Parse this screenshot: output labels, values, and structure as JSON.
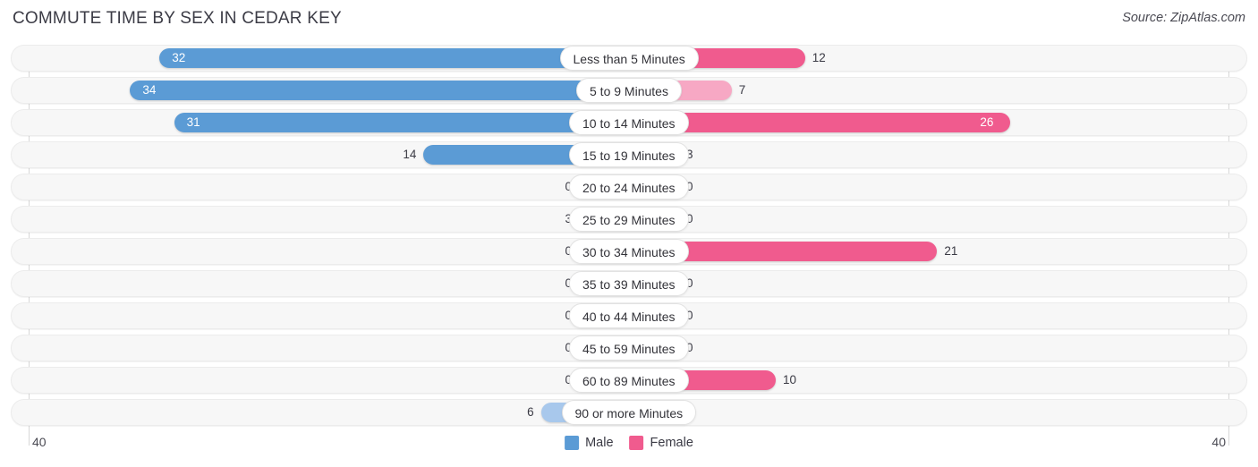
{
  "header": {
    "title": "COMMUTE TIME BY SEX IN CEDAR KEY",
    "source": "Source: ZipAtlas.com"
  },
  "axis": {
    "min_label": "40",
    "max_label": "40"
  },
  "legend": {
    "items": [
      {
        "label": "Male",
        "color": "#5b9bd5"
      },
      {
        "label": "Female",
        "color": "#f05b8e"
      }
    ]
  },
  "colors": {
    "male_strong": "#5b9bd5",
    "male_light": "#a8c8ec",
    "female_strong": "#f05b8e",
    "female_light": "#f7a8c4",
    "track": "#f7f7f7",
    "gridline": "#d8d8d8"
  },
  "chart_data": {
    "type": "bar",
    "title": "COMMUTE TIME BY SEX IN CEDAR KEY",
    "subtitle": "Source: ZipAtlas.com",
    "orientation": "horizontal-diverging",
    "xlabel": "",
    "ylabel": "",
    "xlim": [
      40,
      40
    ],
    "grid": true,
    "legend_position": "bottom-center",
    "categories": [
      "Less than 5 Minutes",
      "5 to 9 Minutes",
      "10 to 14 Minutes",
      "15 to 19 Minutes",
      "20 to 24 Minutes",
      "25 to 29 Minutes",
      "30 to 34 Minutes",
      "35 to 39 Minutes",
      "40 to 44 Minutes",
      "45 to 59 Minutes",
      "60 to 89 Minutes",
      "90 or more Minutes"
    ],
    "series": [
      {
        "name": "Male",
        "color": "#5b9bd5",
        "direction": "left",
        "values": [
          32,
          34,
          31,
          14,
          0,
          3,
          0,
          0,
          0,
          0,
          0,
          6
        ]
      },
      {
        "name": "Female",
        "color": "#f05b8e",
        "direction": "right",
        "values": [
          12,
          7,
          26,
          3,
          0,
          0,
          21,
          0,
          0,
          0,
          10,
          0
        ]
      }
    ]
  }
}
